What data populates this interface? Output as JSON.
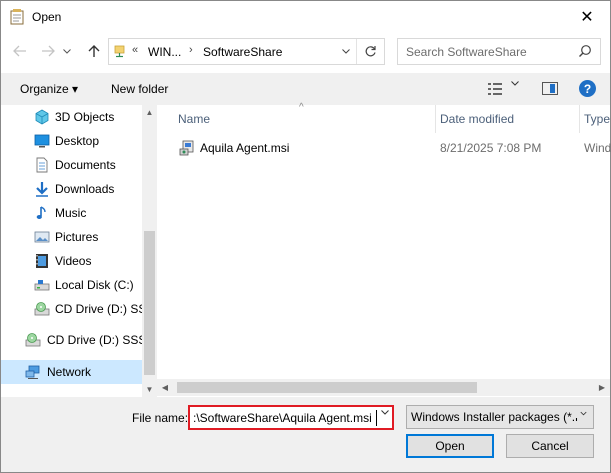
{
  "window": {
    "title": "Open",
    "close_label": "✕"
  },
  "navigation": {
    "back_icon": "arrow-left-icon",
    "forward_icon": "arrow-right-icon",
    "recent_icon": "chevron-down-icon",
    "up_icon": "arrow-up-icon"
  },
  "address": {
    "overflow": "«",
    "crumbs": [
      "WIN...",
      "SoftwareShare"
    ],
    "separator": "›"
  },
  "search": {
    "placeholder": "Search SoftwareShare"
  },
  "toolbar": {
    "organize": "Organize ▾",
    "new_folder": "New folder",
    "help": "?"
  },
  "sidebar": {
    "items": [
      {
        "label": "3D Objects",
        "icon": "3d-objects-icon"
      },
      {
        "label": "Desktop",
        "icon": "desktop-icon"
      },
      {
        "label": "Documents",
        "icon": "documents-icon"
      },
      {
        "label": "Downloads",
        "icon": "downloads-icon"
      },
      {
        "label": "Music",
        "icon": "music-icon"
      },
      {
        "label": "Pictures",
        "icon": "pictures-icon"
      },
      {
        "label": "Videos",
        "icon": "videos-icon"
      },
      {
        "label": "Local Disk (C:)",
        "icon": "local-disk-icon"
      },
      {
        "label": "CD Drive (D:) SSS_",
        "icon": "cd-drive-icon"
      },
      {
        "label": "CD Drive (D:) SSS_",
        "icon": "cd-drive-icon"
      },
      {
        "label": "Network",
        "icon": "network-icon"
      }
    ]
  },
  "columns": [
    "Name",
    "Date modified",
    "Type"
  ],
  "files": [
    {
      "name": "Aquila Agent.msi",
      "date": "8/21/2025 7:08 PM",
      "type": "Wind"
    }
  ],
  "footer": {
    "file_name_label": "File name:",
    "file_name_value": ":\\SoftwareShare\\Aquila Agent.msi",
    "file_type_value": "Windows Installer packages (*.r",
    "open_label": "Open",
    "cancel_label": "Cancel"
  },
  "colors": {
    "accent": "#0078d7",
    "highlight": "#cce8ff",
    "error_outline": "#e01b24"
  }
}
